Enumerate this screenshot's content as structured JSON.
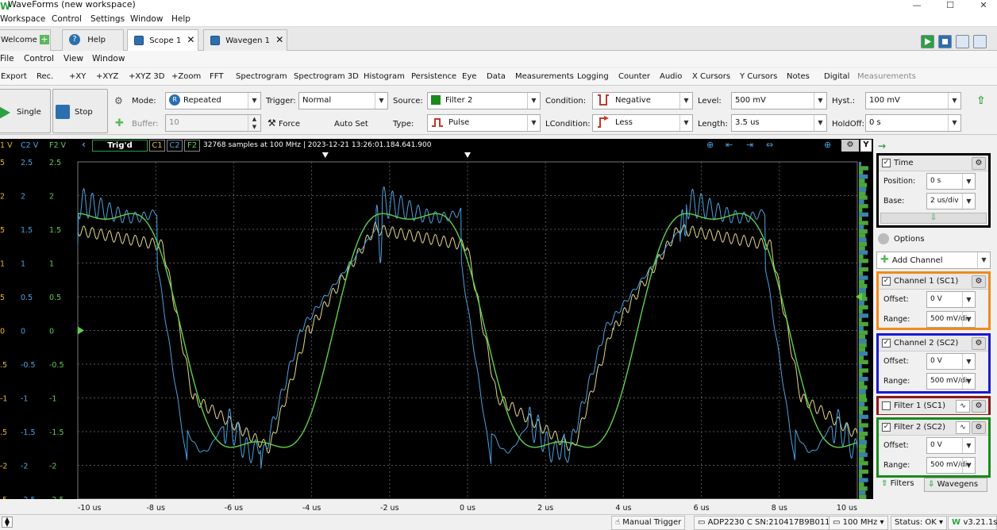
{
  "window": {
    "title": "WaveForms (new workspace)",
    "minimize": "—",
    "maximize": "☐",
    "close": "✕"
  },
  "main_menu": [
    "Workspace",
    "Control",
    "Settings",
    "Window",
    "Help"
  ],
  "tabs": [
    {
      "label": "Welcome"
    },
    {
      "label": "Help"
    },
    {
      "label": "Scope 1",
      "active": true
    },
    {
      "label": "Wavegen 1"
    }
  ],
  "scope_menu": [
    "File",
    "Control",
    "View",
    "Window"
  ],
  "toolbar_items": [
    "Export",
    "Rec.",
    "+XY",
    "+XYZ",
    "+XYZ 3D",
    "+Zoom",
    "FFT",
    "Spectrogram",
    "Spectrogram 3D",
    "Histogram",
    "Persistence",
    "Eye",
    "Data",
    "Measurements",
    "Logging",
    "Counter",
    "Audio",
    "X Cursors",
    "Y Cursors",
    "Notes",
    "Digital",
    "Measurements"
  ],
  "controls": {
    "single_label": "Single",
    "stop_label": "Stop",
    "mode_label": "Mode:",
    "mode_value": "Repeated",
    "buffer_label": "Buffer:",
    "buffer_value": "10",
    "trigger_label": "Trigger:",
    "trigger_value": "Normal",
    "force_label": "Force",
    "autoset_label": "Auto Set",
    "source_label": "Source:",
    "source_value": "Filter 2",
    "type_label": "Type:",
    "type_value": "Pulse",
    "condition_label": "Condition:",
    "condition_value": "Negative",
    "lcondition_label": "LCondition:",
    "lcondition_value": "Less",
    "level_label": "Level:",
    "level_value": "500 mV",
    "length_label": "Length:",
    "length_value": "3.5 us",
    "hyst_label": "Hyst.:",
    "hyst_value": "100 mV",
    "holdoff_label": "HoldOff:",
    "holdoff_value": "0 s"
  },
  "scope_header": {
    "status": "Trig'd",
    "ch_tags": [
      "C1",
      "C2",
      "F2"
    ],
    "info": "32768 samples at 100 MHz  |  2023-12-21 13:26:01.184.641.900",
    "y_button": "Y"
  },
  "axis_headers": [
    "1 V",
    "C2 V",
    "F2 V"
  ],
  "y_ticks": {
    "c1": [
      "5",
      "2",
      "5",
      "1",
      "5",
      "0",
      ".5",
      "-1",
      ".5",
      "-2",
      ".5"
    ],
    "c2": [
      "2.5",
      "2",
      "1.5",
      "1",
      "0.5",
      "0",
      "-0.5",
      "-1",
      "-1.5",
      "-2",
      "-2.5"
    ],
    "f2": [
      "2.5",
      "2",
      "1.5",
      "1",
      "0.5",
      "0",
      "-0.5",
      "-1",
      "-1.5",
      "-2",
      "-2.5"
    ]
  },
  "x_ticks": [
    "-10 us",
    "-8 us",
    "-6 us",
    "-4 us",
    "-2 us",
    "0 us",
    "2 us",
    "4 us",
    "6 us",
    "8 us",
    "10 us"
  ],
  "chart_data": {
    "type": "line",
    "x_range_us": [
      -10,
      10
    ],
    "y_range_v": [
      -2.5,
      2.5
    ],
    "grid": true,
    "series": [
      {
        "name": "C1",
        "color": "#e8d88a"
      },
      {
        "name": "C2",
        "color": "#4aa3df"
      },
      {
        "name": "F2",
        "color": "#5fd04a"
      }
    ]
  },
  "right_panel": {
    "time": {
      "title": "Time",
      "position_label": "Position:",
      "position_value": "0 s",
      "base_label": "Base:",
      "base_value": "2 us/div"
    },
    "options_label": "Options",
    "add_channel_label": "Add Channel",
    "channel1": {
      "title": "Channel 1 (SC1)",
      "offset_label": "Offset:",
      "offset_value": "0 V",
      "range_label": "Range:",
      "range_value": "500 mV/div",
      "border": "#f08a1c"
    },
    "channel2": {
      "title": "Channel 2 (SC2)",
      "offset_label": "Offset:",
      "offset_value": "0 V",
      "range_label": "Range:",
      "range_value": "500 mV/div",
      "border": "#1a1ad0"
    },
    "filter1": {
      "title": "Filter 1 (SC1)",
      "border": "#8b1a1a"
    },
    "filter2": {
      "title": "Filter 2 (SC2)",
      "offset_label": "Offset:",
      "offset_value": "0 V",
      "range_label": "Range:",
      "range_value": "500 mV/div",
      "border": "#1a8a1a"
    },
    "filters_label": "Filters",
    "wavegens_label": "Wavegens"
  },
  "statusbar": {
    "manual_trigger": "Manual Trigger",
    "device": "ADP2230 C SN:210417B9B011",
    "rate": "100 MHz",
    "status": "Status: OK",
    "version": "v3.21.1s"
  }
}
